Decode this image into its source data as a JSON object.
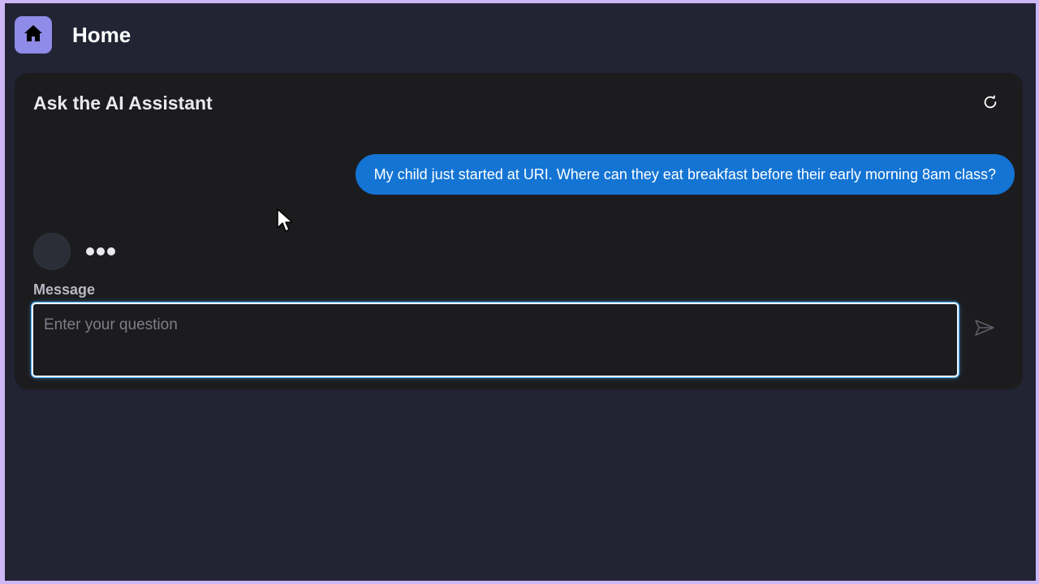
{
  "header": {
    "title": "Home",
    "icon": "home-icon",
    "accent_color": "#8f8be8"
  },
  "chat": {
    "title": "Ask the AI Assistant",
    "refresh_icon": "refresh-icon",
    "messages": [
      {
        "role": "user",
        "text": "My child just started at URI. Where can they eat breakfast before their early morning 8am class?"
      }
    ],
    "assistant_status": "typing",
    "user_bubble_color": "#1474d4"
  },
  "composer": {
    "label": "Message",
    "placeholder": "Enter your question",
    "value": "",
    "send_icon": "send-icon"
  }
}
